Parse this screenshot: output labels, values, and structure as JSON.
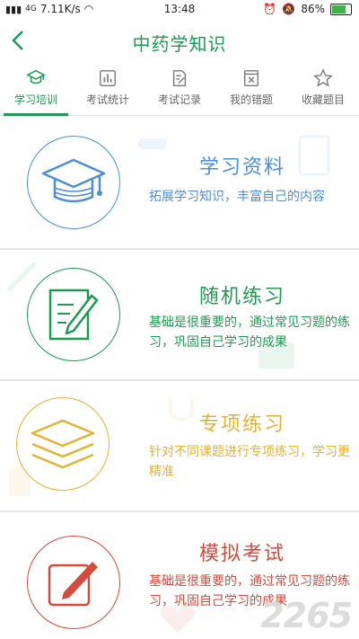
{
  "status_bar": {
    "network": "4G",
    "speed": "7.11K/s",
    "time": "13:48",
    "battery": "86%",
    "battery_level": 0.86
  },
  "header": {
    "title": "中药学知识"
  },
  "tabs": [
    {
      "label": "学习培训",
      "icon": "graduation-cap-icon",
      "active": true
    },
    {
      "label": "考试统计",
      "icon": "bar-chart-icon",
      "active": false
    },
    {
      "label": "考试记录",
      "icon": "edit-doc-icon",
      "active": false
    },
    {
      "label": "我的错题",
      "icon": "x-box-icon",
      "active": false
    },
    {
      "label": "收藏题目",
      "icon": "star-icon",
      "active": false
    }
  ],
  "cards": [
    {
      "title": "学习资料",
      "desc": "拓展学习知识，丰富自己的内容",
      "color": "#4a8fd6",
      "icon": "graduation-cap-icon"
    },
    {
      "title": "随机练习",
      "desc": "基础是很重要的，通过常见习题的练习，巩固自己学习的成果",
      "color": "#1d9b52",
      "icon": "notebook-pen-icon"
    },
    {
      "title": "专项练习",
      "desc": "针对不同课题进行专项练习，学习更精准",
      "color": "#e2b330",
      "icon": "layers-icon"
    },
    {
      "title": "模拟考试",
      "desc": "基础是很重要的，通过常见习题的练习，巩固自己学习的成果",
      "color": "#d44a3c",
      "icon": "pencil-box-icon"
    }
  ],
  "watermark": "2265"
}
